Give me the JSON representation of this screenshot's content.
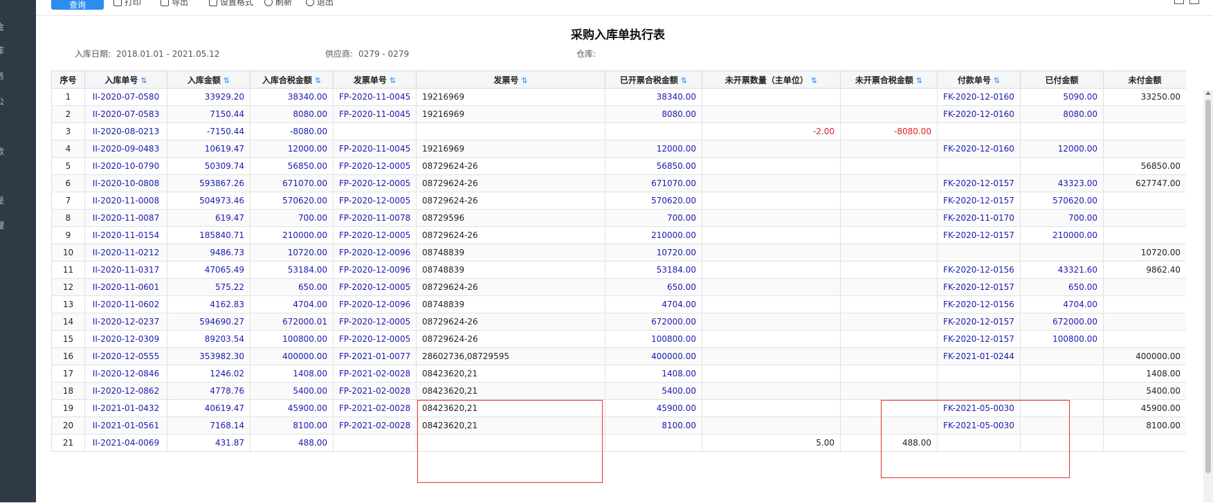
{
  "sidebar": {
    "items": [
      "金",
      "库",
      "务",
      "公",
      "款",
      "是",
      "理"
    ]
  },
  "toolbar": {
    "primary_label": "查询",
    "buttons": [
      {
        "label": "打印",
        "icon": "print-icon"
      },
      {
        "label": "导出",
        "icon": "export-icon"
      },
      {
        "label": "设置格式",
        "icon": "format-icon"
      },
      {
        "label": "刷新",
        "icon": "refresh-icon"
      },
      {
        "label": "退出",
        "icon": "exit-icon"
      }
    ]
  },
  "report": {
    "title": "采购入库单执行表",
    "filters": {
      "date_label": "入库日期:",
      "date_value": "2018.01.01 - 2021.05.12",
      "supplier_label": "供应商:",
      "supplier_value": "0279 - 0279",
      "warehouse_label": "仓库:",
      "warehouse_value": ""
    }
  },
  "table": {
    "headers": [
      "序号",
      "入库单号",
      "入库金额",
      "入库合税金额",
      "发票单号",
      "发票号",
      "已开票合税金额",
      "未开票数量（主单位）",
      "未开票合税金额",
      "付款单号",
      "已付金额",
      "未付金额"
    ],
    "rows": [
      [
        "1",
        "II-2020-07-0580",
        "33929.20",
        "38340.00",
        "FP-2020-11-0045",
        "19216969",
        "38340.00",
        "",
        "",
        "FK-2020-12-0160",
        "5090.00",
        "33250.00"
      ],
      [
        "2",
        "II-2020-07-0583",
        "7150.44",
        "8080.00",
        "FP-2020-11-0045",
        "19216969",
        "8080.00",
        "",
        "",
        "FK-2020-12-0160",
        "8080.00",
        ""
      ],
      [
        "3",
        "II-2020-08-0213",
        "-7150.44",
        "-8080.00",
        "",
        "",
        "",
        "-2.00",
        "-8080.00",
        "",
        "",
        ""
      ],
      [
        "4",
        "II-2020-09-0483",
        "10619.47",
        "12000.00",
        "FP-2020-11-0045",
        "19216969",
        "12000.00",
        "",
        "",
        "FK-2020-12-0160",
        "12000.00",
        ""
      ],
      [
        "5",
        "II-2020-10-0790",
        "50309.74",
        "56850.00",
        "FP-2020-12-0005",
        "08729624-26",
        "56850.00",
        "",
        "",
        "",
        "",
        "56850.00"
      ],
      [
        "6",
        "II-2020-10-0808",
        "593867.26",
        "671070.00",
        "FP-2020-12-0005",
        "08729624-26",
        "671070.00",
        "",
        "",
        "FK-2020-12-0157",
        "43323.00",
        "627747.00"
      ],
      [
        "7",
        "II-2020-11-0008",
        "504973.46",
        "570620.00",
        "FP-2020-12-0005",
        "08729624-26",
        "570620.00",
        "",
        "",
        "FK-2020-12-0157",
        "570620.00",
        ""
      ],
      [
        "8",
        "II-2020-11-0087",
        "619.47",
        "700.00",
        "FP-2020-11-0078",
        "08729596",
        "700.00",
        "",
        "",
        "FK-2020-11-0170",
        "700.00",
        ""
      ],
      [
        "9",
        "II-2020-11-0154",
        "185840.71",
        "210000.00",
        "FP-2020-12-0005",
        "08729624-26",
        "210000.00",
        "",
        "",
        "FK-2020-12-0157",
        "210000.00",
        ""
      ],
      [
        "10",
        "II-2020-11-0212",
        "9486.73",
        "10720.00",
        "FP-2020-12-0096",
        "08748839",
        "10720.00",
        "",
        "",
        "",
        "",
        "10720.00"
      ],
      [
        "11",
        "II-2020-11-0317",
        "47065.49",
        "53184.00",
        "FP-2020-12-0096",
        "08748839",
        "53184.00",
        "",
        "",
        "FK-2020-12-0156",
        "43321.60",
        "9862.40"
      ],
      [
        "12",
        "II-2020-11-0601",
        "575.22",
        "650.00",
        "FP-2020-12-0005",
        "08729624-26",
        "650.00",
        "",
        "",
        "FK-2020-12-0157",
        "650.00",
        ""
      ],
      [
        "13",
        "II-2020-11-0602",
        "4162.83",
        "4704.00",
        "FP-2020-12-0096",
        "08748839",
        "4704.00",
        "",
        "",
        "FK-2020-12-0156",
        "4704.00",
        ""
      ],
      [
        "14",
        "II-2020-12-0237",
        "594690.27",
        "672000.01",
        "FP-2020-12-0005",
        "08729624-26",
        "672000.00",
        "",
        "",
        "FK-2020-12-0157",
        "672000.00",
        ""
      ],
      [
        "15",
        "II-2020-12-0309",
        "89203.54",
        "100800.00",
        "FP-2020-12-0005",
        "08729624-26",
        "100800.00",
        "",
        "",
        "FK-2020-12-0157",
        "100800.00",
        ""
      ],
      [
        "16",
        "II-2020-12-0555",
        "353982.30",
        "400000.00",
        "FP-2021-01-0077",
        "28602736,08729595",
        "400000.00",
        "",
        "",
        "FK-2021-01-0244",
        "",
        "400000.00"
      ],
      [
        "17",
        "II-2020-12-0846",
        "1246.02",
        "1408.00",
        "FP-2021-02-0028",
        "08423620,21",
        "1408.00",
        "",
        "",
        "",
        "",
        "1408.00"
      ],
      [
        "18",
        "II-2020-12-0862",
        "4778.76",
        "5400.00",
        "FP-2021-02-0028",
        "08423620,21",
        "5400.00",
        "",
        "",
        "",
        "",
        "5400.00"
      ],
      [
        "19",
        "II-2021-01-0432",
        "40619.47",
        "45900.00",
        "FP-2021-02-0028",
        "08423620,21",
        "45900.00",
        "",
        "",
        "FK-2021-05-0030",
        "",
        "45900.00"
      ],
      [
        "20",
        "II-2021-01-0561",
        "7168.14",
        "8100.00",
        "FP-2021-02-0028",
        "08423620,21",
        "8100.00",
        "",
        "",
        "FK-2021-05-0030",
        "",
        "8100.00"
      ],
      [
        "21",
        "II-2021-04-0069",
        "431.87",
        "488.00",
        "",
        "",
        "",
        "5.00",
        "488.00",
        "",
        "",
        ""
      ]
    ]
  },
  "colors": {
    "link": "#1a1aaf",
    "negative": "#e02020",
    "highlight_box": "#e03030",
    "sidebar": "#2f3a47",
    "primary": "#2d8cf0"
  }
}
